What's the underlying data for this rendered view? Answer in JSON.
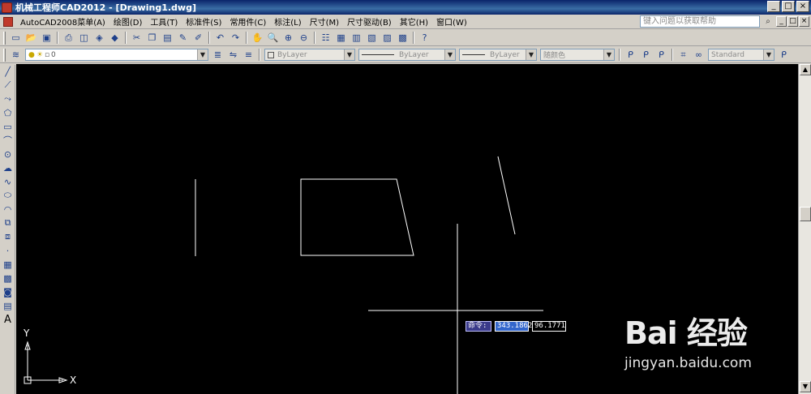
{
  "window": {
    "title": "机械工程师CAD2012 - [Drawing1.dwg]",
    "controls": [
      "_",
      "□",
      "×"
    ]
  },
  "menubar": {
    "items": [
      "AutoCAD2008菜单(A)",
      "绘图(D)",
      "工具(T)",
      "标准件(S)",
      "常用件(C)",
      "标注(L)",
      "尺寸(M)",
      "尺寸驱动(B)",
      "其它(H)",
      "窗口(W)"
    ],
    "help_placeholder": "键入问题以获取帮助",
    "help_icons": [
      "search-icon",
      "dropdown-icon",
      "star-icon",
      "help-icon"
    ],
    "mdi_controls": [
      "_",
      "□",
      "×"
    ]
  },
  "toolbar1": {
    "icons": [
      "new-icon",
      "open-icon",
      "save-icon",
      "print-icon",
      "preview-icon",
      "publish-icon",
      "3d-icon",
      "cut-icon",
      "copy-icon",
      "paste-icon",
      "match-props-icon",
      "block-editor-icon",
      "undo-icon",
      "redo-icon",
      "pan-icon",
      "zoom-realtime-icon",
      "zoom-window-icon",
      "zoom-previous-icon",
      "properties-icon",
      "design-center-icon",
      "tool-palettes-icon",
      "sheet-set-icon",
      "markup-icon",
      "calculator-icon",
      "help-icon"
    ]
  },
  "toolbar2": {
    "layer_value": "0",
    "color_value": "ByLayer",
    "linetype_value": "ByLayer",
    "lineweight_value": "ByLayer",
    "plotstyle_value": "随颜色",
    "textstyle_value": "Standard"
  },
  "left_toolbar": {
    "icons": [
      "line-icon",
      "construction-line-icon",
      "polyline-icon",
      "polygon-icon",
      "rectangle-icon",
      "arc-icon",
      "circle-icon",
      "revision-cloud-icon",
      "spline-icon",
      "ellipse-icon",
      "ellipse-arc-icon",
      "insert-block-icon",
      "make-block-icon",
      "point-icon",
      "hatch-icon",
      "gradient-icon",
      "region-icon",
      "table-icon",
      "multiline-text-icon"
    ]
  },
  "canvas": {
    "ucs_x": "X",
    "ucs_y": "Y"
  },
  "dynamic_input": {
    "prompt": "命令:",
    "x_value": "343.1862",
    "y_value": "96.1771"
  },
  "watermark": {
    "brand": "Bai 经验",
    "url": "jingyan.baidu.com"
  },
  "colors": {
    "canvas_bg": "#000000",
    "title_bar": "#0a246a",
    "chrome": "#d4d0c8",
    "geometry": "#ffffff",
    "dyn_input_highlight": "#3366cc"
  }
}
